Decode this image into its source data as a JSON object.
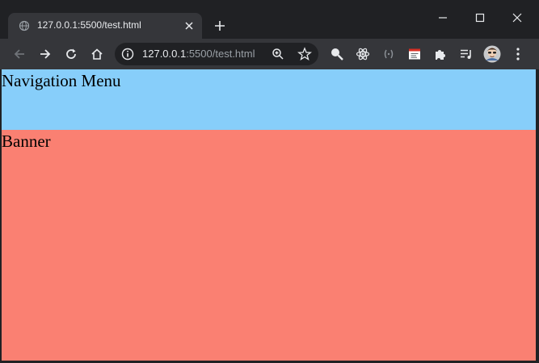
{
  "browser": {
    "tab": {
      "title": "127.0.0.1:5500/test.html",
      "favicon": "globe-icon"
    },
    "address_bar": {
      "host": "127.0.0.1",
      "path": ":5500/test.html"
    },
    "toolbar_icons": [
      "back-arrow-icon",
      "forward-arrow-icon",
      "reload-icon",
      "home-icon",
      "zoom-icon",
      "star-icon",
      "search-extension-icon",
      "react-extension-icon",
      "parens-extension-icon",
      "window-extension-icon",
      "puzzle-icon",
      "playlist-icon",
      "avatar",
      "kebab-menu-icon"
    ],
    "window_controls": [
      "minimize-icon",
      "maximize-icon",
      "close-icon"
    ]
  },
  "page": {
    "nav_menu": {
      "text": "Navigation Menu",
      "background": "#87cefa"
    },
    "banner": {
      "text": "Banner",
      "background": "#fa8072"
    }
  },
  "colors": {
    "frame": "#202124",
    "toolbar": "#35363a",
    "tab_active": "#35363a"
  }
}
